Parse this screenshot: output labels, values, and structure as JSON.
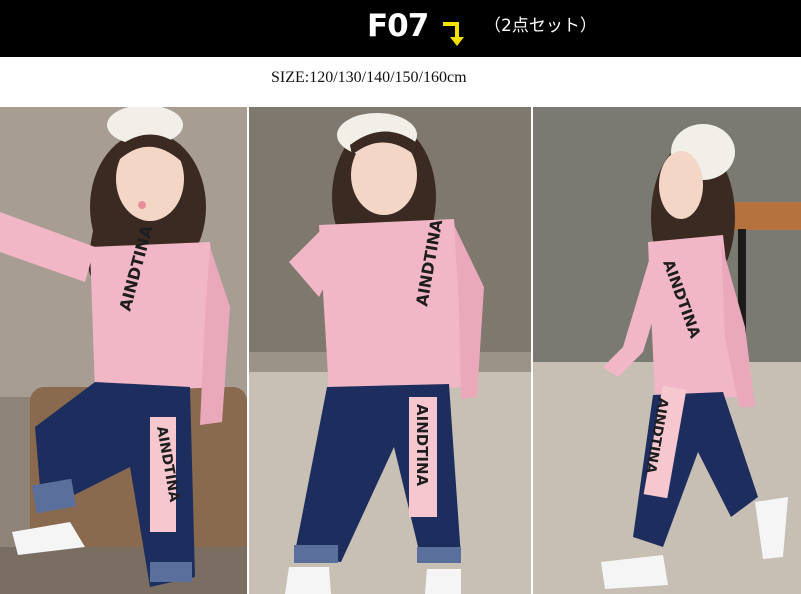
{
  "header": {
    "product_code": "F07",
    "set_label": "（2点セット）",
    "arrow_icon": "arrow-down-right-icon",
    "arrow_color": "#f5e100",
    "background": "#000000"
  },
  "size_line": "SIZE:120/130/140/150/160cm",
  "photos": [
    {
      "print_text": "AINDTINA",
      "pants_text": "AINDTINA"
    },
    {
      "print_text": "AINDTINA",
      "pants_text": "AINDTINA"
    },
    {
      "print_text": "AINDTINA",
      "pants_text": "AINDTINA"
    }
  ],
  "colors": {
    "top": "#f2b7c6",
    "pants": "#1d2e5e",
    "cap": "#f2efe9"
  }
}
